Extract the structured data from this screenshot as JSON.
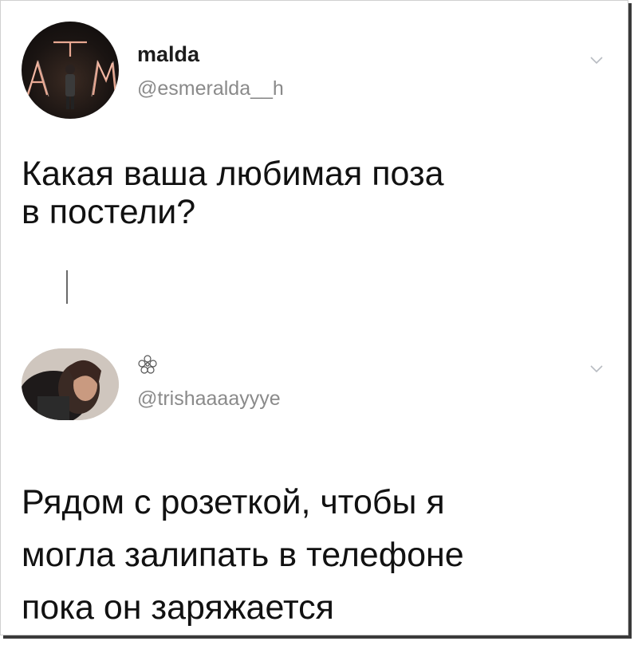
{
  "tweets": [
    {
      "name": "malda",
      "handle": "@esmeralda__h",
      "text_lines": [
        "Какая ваша любимая поза",
        "в постели?"
      ],
      "avatar_letters": "ATM",
      "icon": "chevron-down-icon"
    },
    {
      "name_icon": "flower-icon",
      "handle": "@trishaaaayyye",
      "text_lines": [
        "Рядом с розеткой, чтобы я",
        "могла залипать в телефоне",
        "пока он заряжается"
      ],
      "icon": "chevron-down-icon"
    }
  ],
  "colors": {
    "text": "#111111",
    "handle": "#8a8a8a",
    "chevron": "#b8bcc2"
  }
}
